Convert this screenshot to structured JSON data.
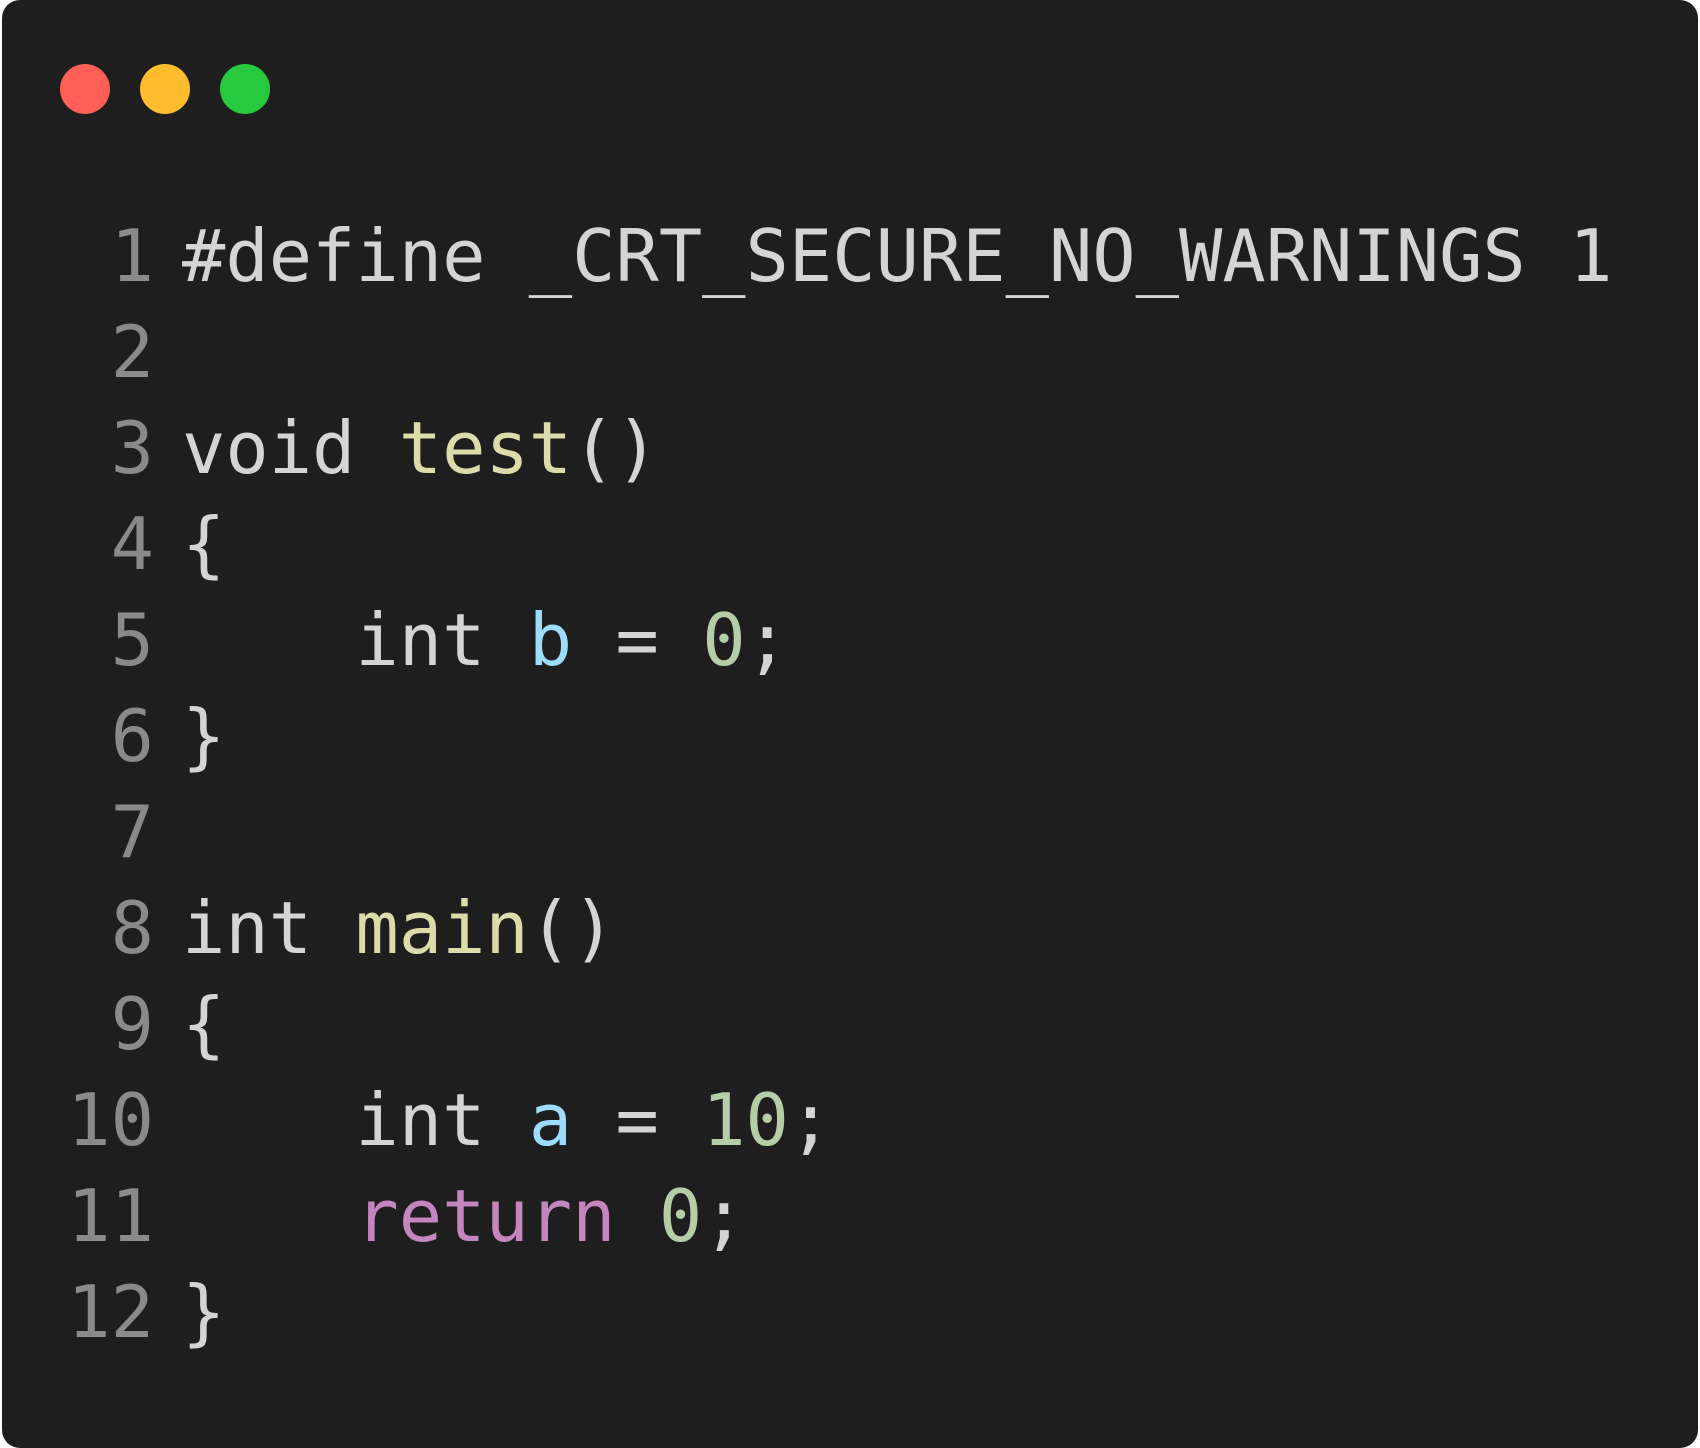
{
  "window": {
    "controls": [
      {
        "name": "close",
        "color": "#ff5f56"
      },
      {
        "name": "minimize",
        "color": "#ffbd2e"
      },
      {
        "name": "zoom",
        "color": "#27c93f"
      }
    ]
  },
  "colors": {
    "background": "#1e1e1e",
    "text": "#d4d4d4",
    "line_number": "#8a8a8a",
    "function": "#dcdcaa",
    "variable": "#9cdcfe",
    "number": "#b5cea8",
    "control_keyword": "#c586c0"
  },
  "code": {
    "lines": [
      {
        "number": "1",
        "tokens": [
          {
            "t": "#define _CRT_SECURE_NO_WARNINGS 1",
            "k": "text"
          }
        ]
      },
      {
        "number": "2",
        "tokens": []
      },
      {
        "number": "3",
        "tokens": [
          {
            "t": "void ",
            "k": "text"
          },
          {
            "t": "test",
            "k": "function"
          },
          {
            "t": "()",
            "k": "text"
          }
        ]
      },
      {
        "number": "4",
        "tokens": [
          {
            "t": "{",
            "k": "text"
          }
        ]
      },
      {
        "number": "5",
        "tokens": [
          {
            "t": "    int ",
            "k": "text"
          },
          {
            "t": "b",
            "k": "variable"
          },
          {
            "t": " = ",
            "k": "text"
          },
          {
            "t": "0",
            "k": "number"
          },
          {
            "t": ";",
            "k": "text"
          }
        ]
      },
      {
        "number": "6",
        "tokens": [
          {
            "t": "}",
            "k": "text"
          }
        ]
      },
      {
        "number": "7",
        "tokens": []
      },
      {
        "number": "8",
        "tokens": [
          {
            "t": "int ",
            "k": "text"
          },
          {
            "t": "main",
            "k": "function"
          },
          {
            "t": "()",
            "k": "text"
          }
        ]
      },
      {
        "number": "9",
        "tokens": [
          {
            "t": "{",
            "k": "text"
          }
        ]
      },
      {
        "number": "10",
        "tokens": [
          {
            "t": "    int ",
            "k": "text"
          },
          {
            "t": "a",
            "k": "variable"
          },
          {
            "t": " = ",
            "k": "text"
          },
          {
            "t": "10",
            "k": "number"
          },
          {
            "t": ";",
            "k": "text"
          }
        ]
      },
      {
        "number": "11",
        "tokens": [
          {
            "t": "    ",
            "k": "text"
          },
          {
            "t": "return",
            "k": "control_keyword"
          },
          {
            "t": " ",
            "k": "text"
          },
          {
            "t": "0",
            "k": "number"
          },
          {
            "t": ";",
            "k": "text"
          }
        ]
      },
      {
        "number": "12",
        "tokens": [
          {
            "t": "}",
            "k": "text"
          }
        ]
      }
    ]
  }
}
